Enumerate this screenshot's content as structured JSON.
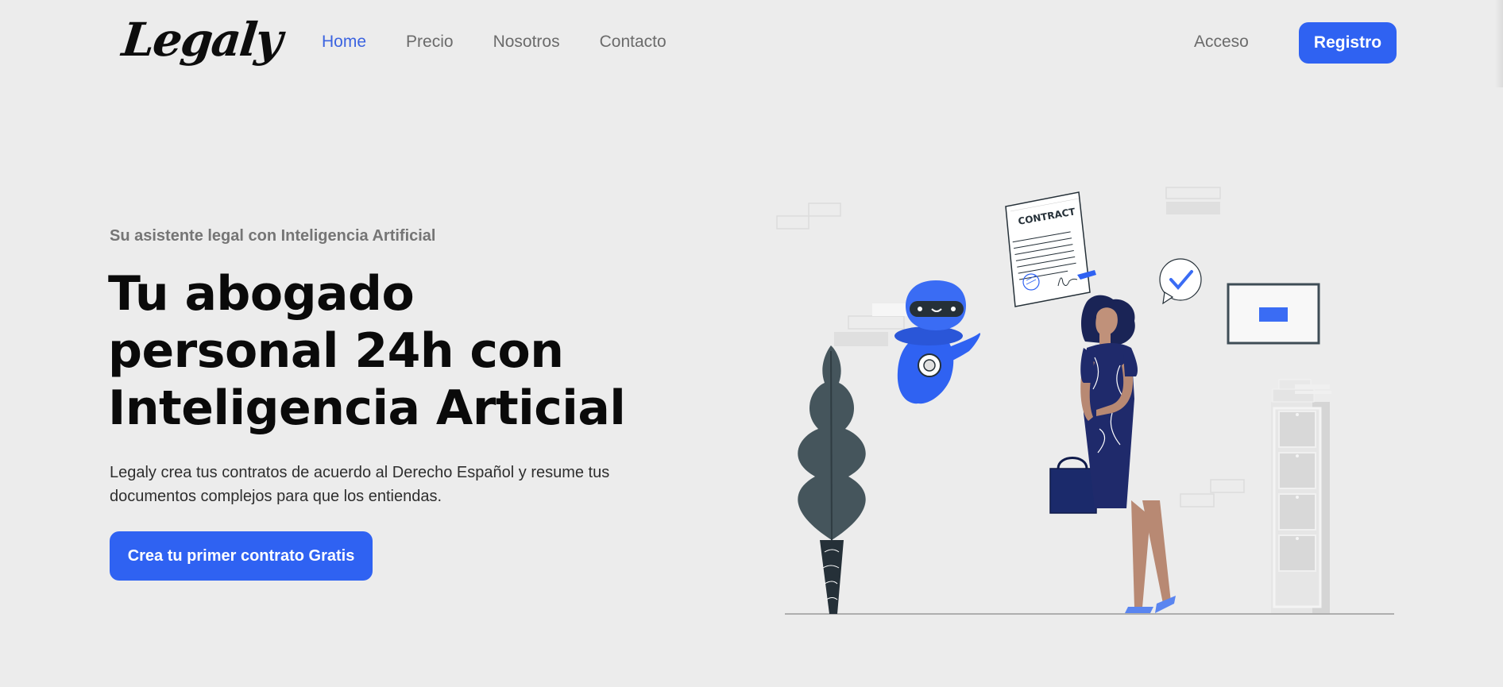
{
  "nav": {
    "logo": "Legaly",
    "links": [
      {
        "label": "Home",
        "active": true
      },
      {
        "label": "Precio",
        "active": false
      },
      {
        "label": "Nosotros",
        "active": false
      },
      {
        "label": "Contacto",
        "active": false
      }
    ],
    "login_label": "Acceso",
    "register_label": "Registro"
  },
  "hero": {
    "eyebrow": "Su asistente legal con Inteligencia Artificial",
    "title_lines": [
      "Tu abogado",
      "personal 24h con",
      "Inteligencia Articial"
    ],
    "description": "Legaly crea tus contratos de acuerdo al Derecho Español y resume tus documentos complejos para que los entiendas.",
    "cta_label": "Crea tu primer contrato Gratis"
  },
  "illustration": {
    "contract_label": "CONTRACT"
  },
  "colors": {
    "accent": "#2f62f2",
    "nav_active": "#3b63e0",
    "background": "#ececec",
    "navy": "#1f2a6b"
  }
}
